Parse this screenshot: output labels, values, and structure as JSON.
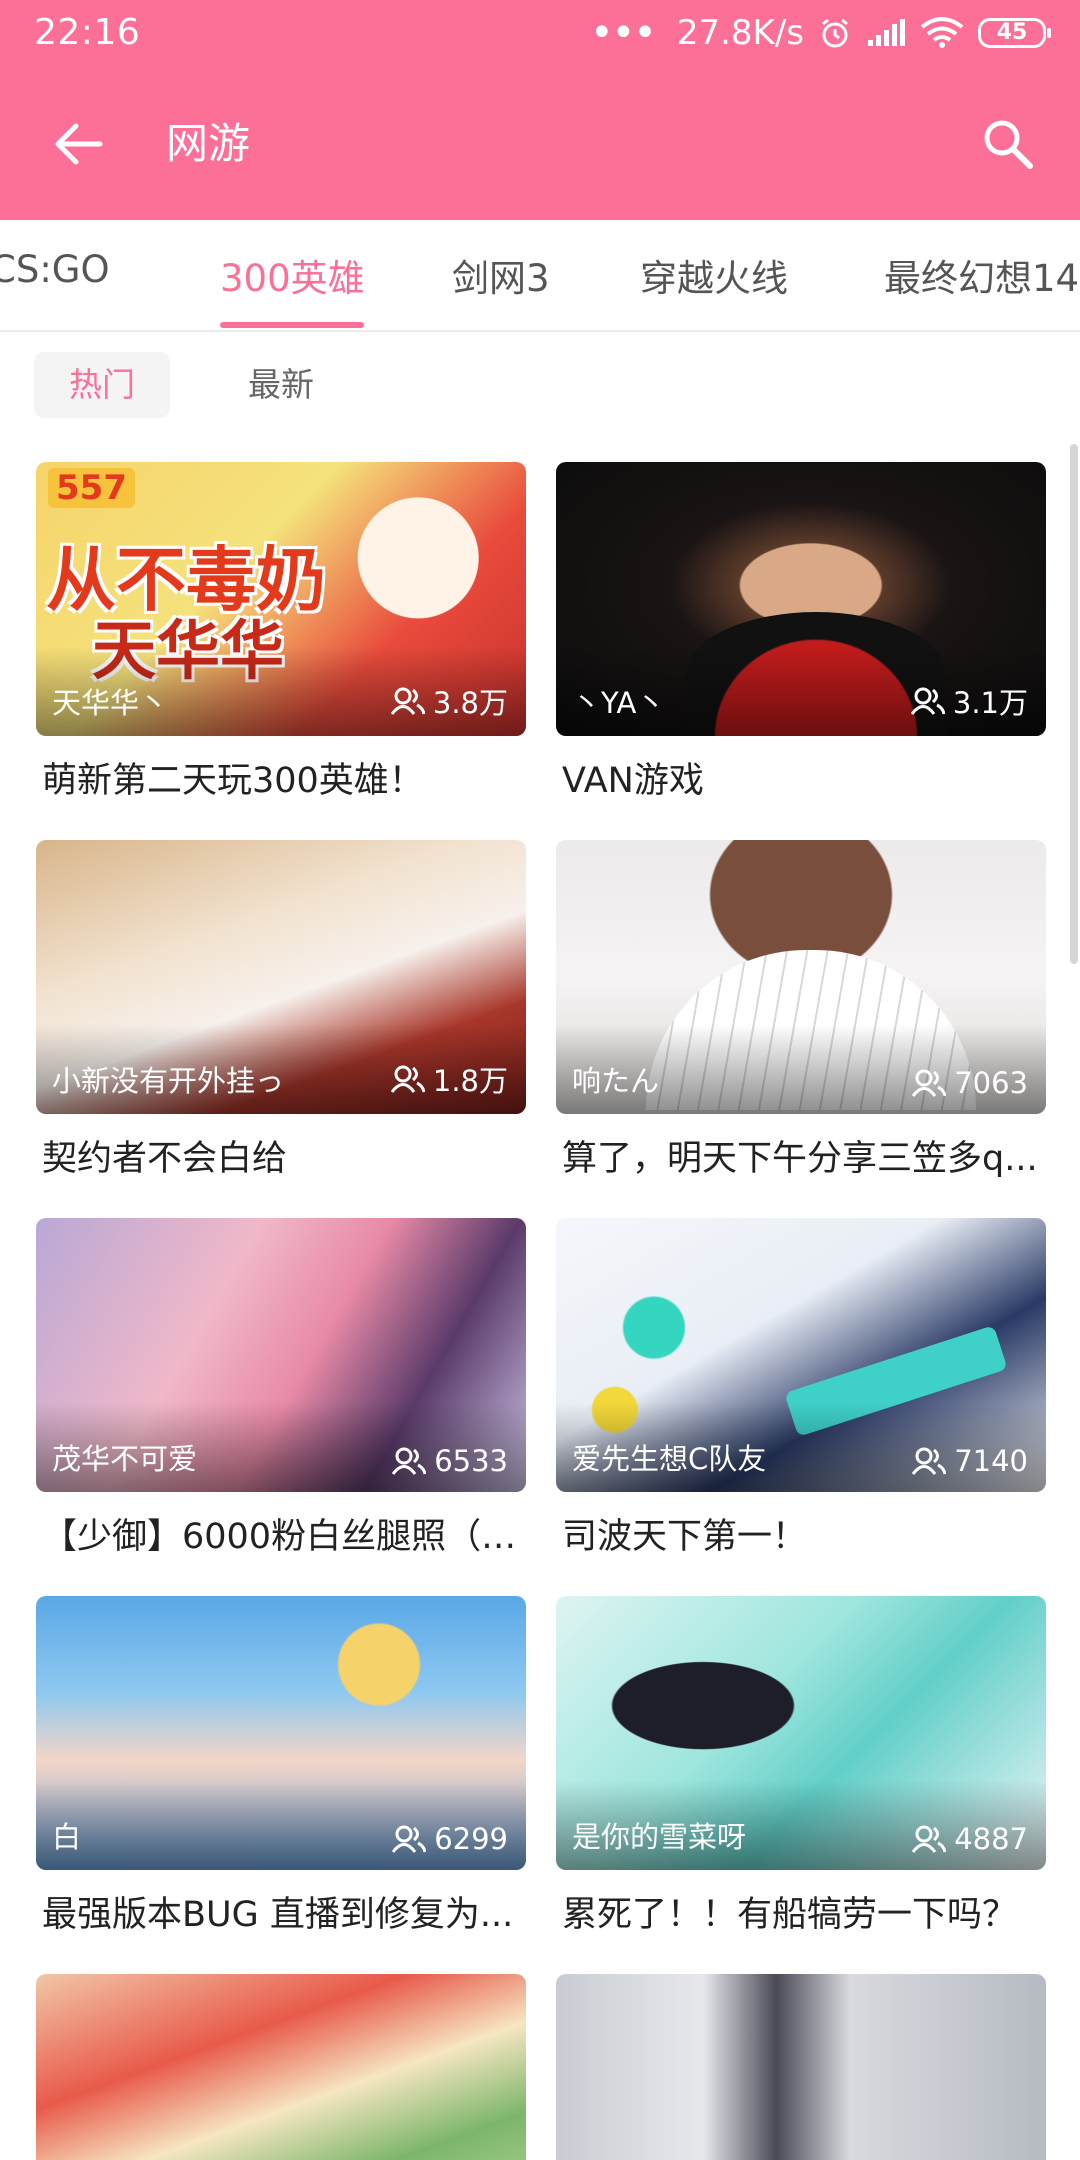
{
  "status": {
    "time": "22:16",
    "network_speed": "27.8K/s",
    "battery": "45",
    "icons": [
      "more-dots-icon",
      "alarm-icon",
      "signal-icon",
      "wifi-icon",
      "battery-icon"
    ]
  },
  "app_bar": {
    "title": "网游",
    "back_icon": "arrow-left-icon",
    "search_icon": "search-icon"
  },
  "tabs": [
    {
      "label": "CS:GO"
    },
    {
      "label": "300英雄"
    },
    {
      "label": "剑网3"
    },
    {
      "label": "穿越火线"
    },
    {
      "label": "最终幻想14"
    }
  ],
  "active_tab": "300英雄",
  "sort": {
    "hot": "热门",
    "new": "最新",
    "selected": "热门"
  },
  "cards": [
    {
      "uploader": "天华华丶",
      "viewers": "3.8万",
      "title": "萌新第二天玩300英雄！",
      "thumb_text": [
        "从不毒奶",
        "天华华"
      ],
      "thumb_badge": "557"
    },
    {
      "uploader": "丶YA丶",
      "viewers": "3.1万",
      "title": "VAN游戏"
    },
    {
      "uploader": "小新没有开外挂っ",
      "viewers": "1.8万",
      "title": "契约者不会白给"
    },
    {
      "uploader": "响たん",
      "viewers": "7063",
      "title": "算了，明天下午分享三笠多q..."
    },
    {
      "uploader": "茂华不可爱",
      "viewers": "6533",
      "title": "【少御】6000粉白丝腿照（重..."
    },
    {
      "uploader": "爱先生想C队友",
      "viewers": "7140",
      "title": "司波天下第一！"
    },
    {
      "uploader": "白",
      "viewers": "6299",
      "title": "最强版本BUG 直播到修复为..."
    },
    {
      "uploader": "是你的雪菜呀",
      "viewers": "4887",
      "title": "累死了！！有船犒劳一下吗？"
    },
    {
      "uploader": "",
      "viewers": "",
      "title": ""
    },
    {
      "uploader": "",
      "viewers": "",
      "title": ""
    }
  ],
  "colors": {
    "accent": "#fc6f97",
    "text": "#222222",
    "muted": "#666666"
  }
}
